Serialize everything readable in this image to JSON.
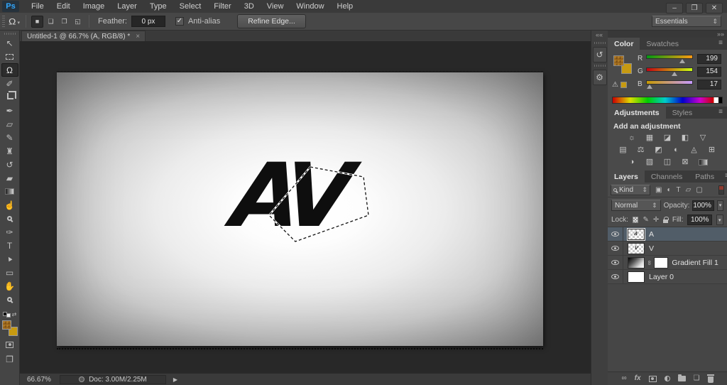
{
  "colors": {
    "accent_blue": "#31a8ff",
    "foreground_swatch": "#9a661c",
    "background_swatch": "#c79a11",
    "selected_layer_bg": "#515d68",
    "pasteboard": "#282828"
  },
  "titlebar": {
    "logo": "Ps",
    "menus": [
      "File",
      "Edit",
      "Image",
      "Layer",
      "Type",
      "Select",
      "Filter",
      "3D",
      "View",
      "Window",
      "Help"
    ],
    "minimize": "–",
    "restore": "❐",
    "close": "✕"
  },
  "options": {
    "tool_icon": "Ω",
    "tool_caret": "▾",
    "mode_new": "■",
    "mode_add": "❏",
    "mode_subtract": "❐",
    "mode_intersect": "◱",
    "feather_label": "Feather:",
    "feather_value": "0 px",
    "check_glyph": "✓",
    "antialias_label": "Anti-alias",
    "refine_edge_label": "Refine Edge...",
    "workspace": "Essentials",
    "workspace_caret": "⇕"
  },
  "doc_tab": {
    "title": "Untitled-1 @ 66.7% (A, RGB/8) *",
    "close": "×"
  },
  "toolbar": {
    "tools": [
      {
        "name": "move-tool",
        "glyph": "↖"
      },
      {
        "name": "rectangular-marquee-tool",
        "glyph": ""
      },
      {
        "name": "lasso-tool",
        "glyph": "Ω"
      },
      {
        "name": "quick-selection-tool",
        "glyph": "✐"
      },
      {
        "name": "crop-tool",
        "glyph": ""
      },
      {
        "name": "eyedropper-tool",
        "glyph": "✒"
      },
      {
        "name": "spot-healing-brush-tool",
        "glyph": "▱"
      },
      {
        "name": "brush-tool",
        "glyph": "✎"
      },
      {
        "name": "clone-stamp-tool",
        "glyph": "♜"
      },
      {
        "name": "history-brush-tool",
        "glyph": "↺"
      },
      {
        "name": "eraser-tool",
        "glyph": "▰"
      },
      {
        "name": "gradient-tool",
        "glyph": ""
      },
      {
        "name": "smudge-tool",
        "glyph": "☝"
      },
      {
        "name": "dodge-tool",
        "glyph": ""
      },
      {
        "name": "pen-tool",
        "glyph": "✑"
      },
      {
        "name": "type-tool",
        "glyph": "T"
      },
      {
        "name": "path-selection-tool",
        "glyph": "▲"
      },
      {
        "name": "rectangle-tool",
        "glyph": "▭"
      },
      {
        "name": "hand-tool",
        "glyph": "✋"
      },
      {
        "name": "zoom-tool",
        "glyph": ""
      }
    ],
    "swap_arrow": "⇄"
  },
  "canvas": {
    "logo_text": "AV"
  },
  "statusbar": {
    "zoom_level": "66.67%",
    "doc_info": "Doc: 3.00M/2.25M",
    "arrow": "▶"
  },
  "dock_strip": {
    "collapse_left": "««",
    "collapse_right": "»»",
    "history_glyph": "↺",
    "properties_glyph": "⚙"
  },
  "color_panel": {
    "tab_color": "Color",
    "tab_swatches": "Swatches",
    "menu_icon": "≡",
    "warning_glyph": "⚠",
    "channels": [
      {
        "label": "R",
        "value": "199"
      },
      {
        "label": "G",
        "value": "154"
      },
      {
        "label": "B",
        "value": "17"
      }
    ]
  },
  "adjustments_panel": {
    "tab_adjustments": "Adjustments",
    "tab_styles": "Styles",
    "menu_icon": "≡",
    "header": "Add an adjustment",
    "row1": [
      {
        "name": "brightness-contrast-icon",
        "glyph": "☼"
      },
      {
        "name": "levels-icon",
        "glyph": "▦"
      },
      {
        "name": "curves-icon",
        "glyph": "◪"
      },
      {
        "name": "exposure-icon",
        "glyph": "◧"
      },
      {
        "name": "vibrance-icon",
        "glyph": "▽"
      }
    ],
    "row2": [
      {
        "name": "hue-saturation-icon",
        "glyph": "▤"
      },
      {
        "name": "color-balance-icon",
        "glyph": "⚖"
      },
      {
        "name": "black-white-icon",
        "glyph": "◩"
      },
      {
        "name": "photo-filter-icon",
        "glyph": "◐"
      },
      {
        "name": "channel-mixer-icon",
        "glyph": "◬"
      },
      {
        "name": "color-lookup-icon",
        "glyph": "⊞"
      }
    ],
    "row3": [
      {
        "name": "invert-icon",
        "glyph": "◑"
      },
      {
        "name": "posterize-icon",
        "glyph": "▨"
      },
      {
        "name": "threshold-icon",
        "glyph": "◫"
      },
      {
        "name": "selective-color-icon",
        "glyph": "⊠"
      }
    ]
  },
  "layers_panel": {
    "tab_layers": "Layers",
    "tab_channels": "Channels",
    "tab_paths": "Paths",
    "menu_icon": "≡",
    "kind_label": "Kind",
    "updown_glyph": "⇕",
    "filter_icons": [
      {
        "name": "filter-pixel-icon",
        "glyph": "▣"
      },
      {
        "name": "filter-adjustment-icon",
        "glyph": "◐"
      },
      {
        "name": "filter-type-icon",
        "glyph": "T"
      },
      {
        "name": "filter-shape-icon",
        "glyph": "▱"
      },
      {
        "name": "filter-smart-object-icon",
        "glyph": "▢"
      }
    ],
    "blend_mode": "Normal",
    "opacity_label": "Opacity:",
    "opacity_value": "100%",
    "caret": "▾",
    "lock_label": "Lock:",
    "lock_brush_glyph": "✎",
    "lock_move_glyph": "✛",
    "fill_label": "Fill:",
    "fill_value": "100%",
    "layers": [
      {
        "name": "A"
      },
      {
        "name": "V"
      },
      {
        "name": "Gradient Fill 1"
      },
      {
        "name": "Layer 0"
      }
    ],
    "bottom": {
      "link": "∞",
      "fx": "fx",
      "new_layer": "❏"
    }
  }
}
